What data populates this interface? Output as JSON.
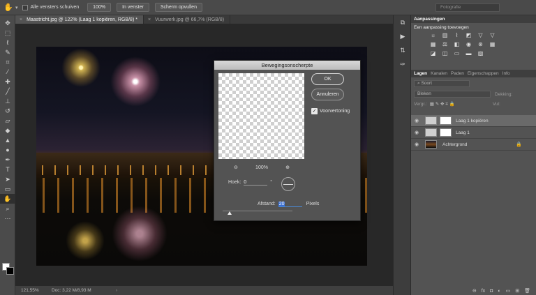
{
  "options_bar": {
    "tool_icon": "hand-icon",
    "scroll_all_label": "Alle vensters schuiven",
    "zoom_value": "100%",
    "fit_screen_label": "In venster",
    "fill_screen_label": "Scherm opvullen",
    "workspace": "Fotografie"
  },
  "tabs": [
    {
      "label": "Maastricht.jpg @ 122% (Laag 1 kopiëren, RGB/8) *"
    },
    {
      "label": "Vuurwerk.jpg @ 66,7% (RGB/8)"
    }
  ],
  "status": {
    "zoom": "121,55%",
    "doc": "Doc: 3,22 M/8,93 M"
  },
  "dialog": {
    "title": "Bewegingsonscherpte",
    "ok_label": "OK",
    "cancel_label": "Annuleren",
    "preview_label": "Voorvertoning",
    "preview_checked": true,
    "preview_zoom": "100%",
    "angle_label": "Hoek:",
    "angle_value": "0",
    "angle_unit": "°",
    "distance_label": "Afstand:",
    "distance_value": "20",
    "distance_unit": "Pixels",
    "distance_slider_fraction": 0.1
  },
  "adjustments": {
    "title": "Aanpassingen",
    "subtitle": "Een aanpassing toevoegen",
    "icons": [
      "brightness-icon",
      "levels-icon",
      "curves-icon",
      "exposure-icon",
      "vibrance-icon",
      "triangle-icon",
      "hue-icon",
      "color-balance-icon",
      "bw-icon",
      "photo-filter-icon",
      "channel-mixer-icon",
      "color-lookup-icon",
      "invert-icon",
      "posterize-icon",
      "threshold-icon",
      "gradient-map-icon",
      "selective-color-icon"
    ]
  },
  "layers_panel": {
    "tabs": [
      "Lagen",
      "Kanalen",
      "Paden",
      "Eigenschappen",
      "Info"
    ],
    "filter_placeholder": "Soort",
    "blend_mode": "Bleken",
    "opacity_label": "Dekking:",
    "lock_label": "Vergr.:",
    "fill_label": "Vul:",
    "layers": [
      {
        "name": "Laag 1 kopiëren",
        "selected": true
      },
      {
        "name": "Laag 1",
        "selected": false
      },
      {
        "name": "Achtergrond",
        "selected": false,
        "locked": true
      }
    ]
  },
  "colors": {
    "accent": "#3b6fd0",
    "panel": "#535353",
    "canvas": "#282828"
  }
}
